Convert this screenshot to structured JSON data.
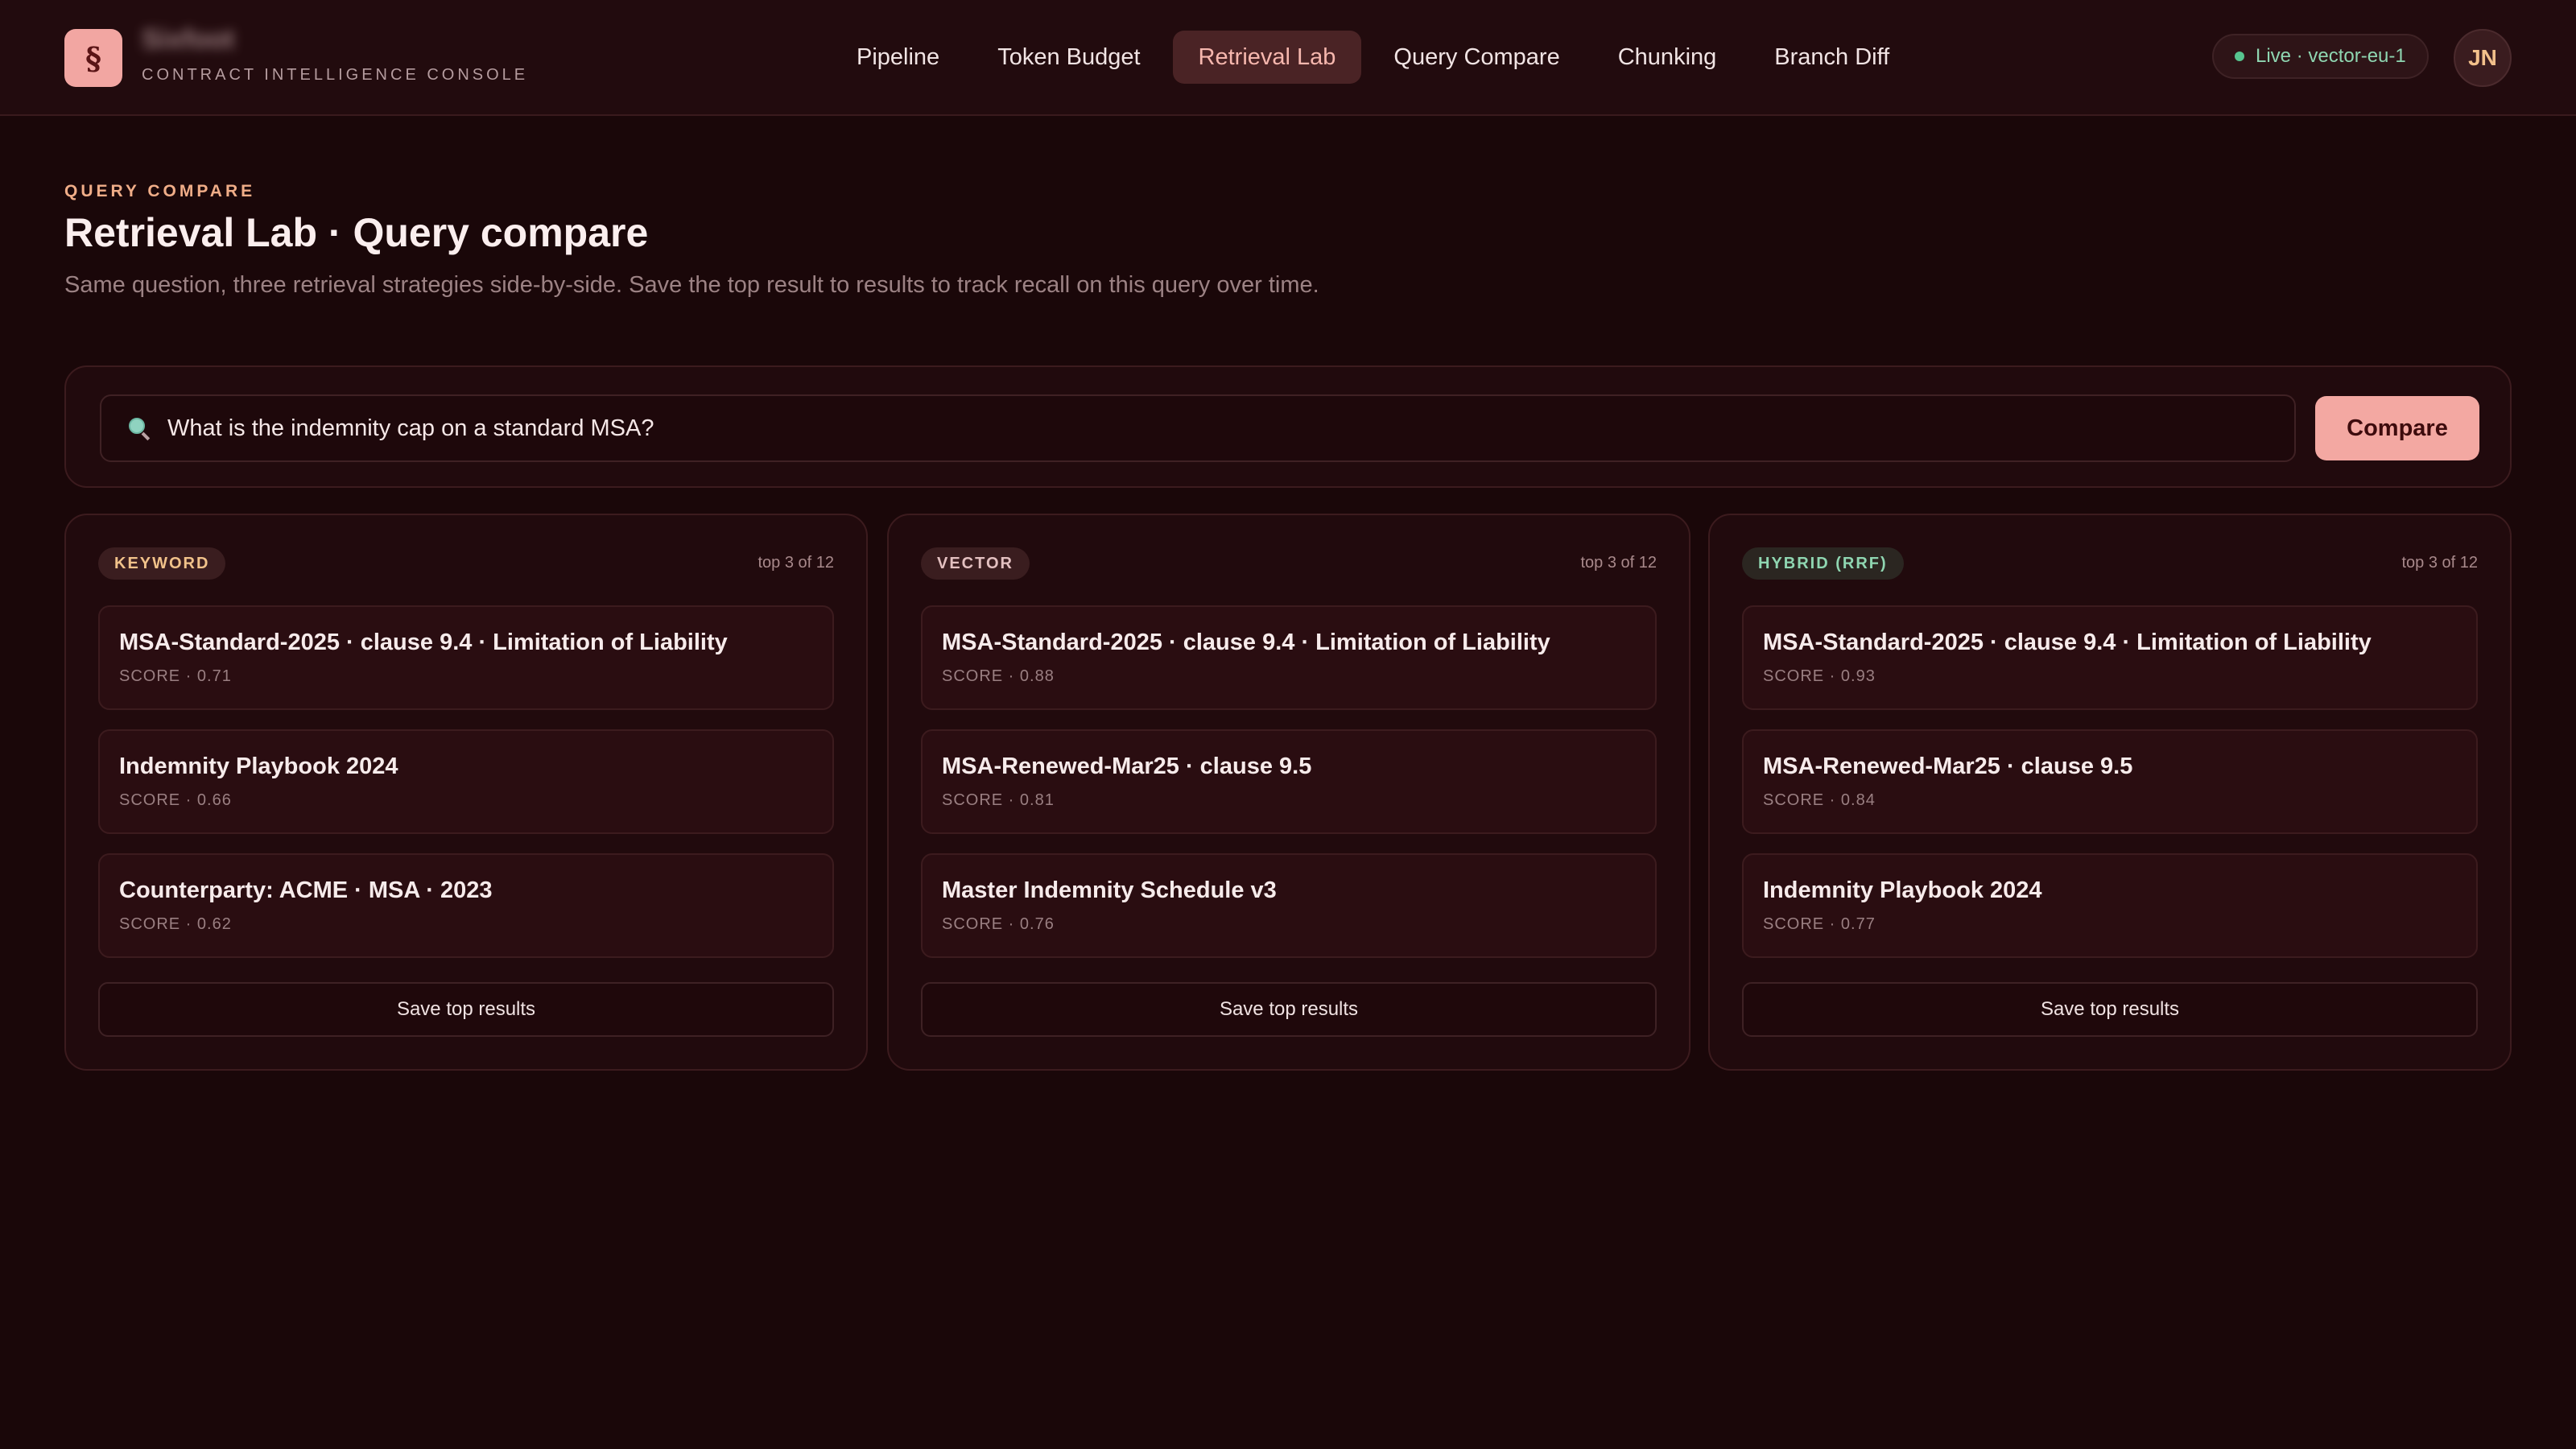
{
  "app": {
    "brand_name": "Sixfoot",
    "subtitle": "CONTRACT INTELLIGENCE CONSOLE",
    "logo_glyph": "§",
    "logo_color": "#f2a6a2"
  },
  "nav": {
    "items": [
      {
        "label": "Pipeline",
        "active": false
      },
      {
        "label": "Token Budget",
        "active": false
      },
      {
        "label": "Retrieval Lab",
        "active": true
      },
      {
        "label": "Query Compare",
        "active": false
      },
      {
        "label": "Chunking",
        "active": false
      },
      {
        "label": "Branch Diff",
        "active": false
      }
    ]
  },
  "status": {
    "label": "Live · vector-eu-1",
    "color": "#57c48f"
  },
  "user": {
    "initials": "JN"
  },
  "page": {
    "eyebrow": "QUERY COMPARE",
    "title": "Retrieval Lab · Query compare",
    "description": "Same question, three retrieval strategies side-by-side. Save the top result to results to track recall on this query over time."
  },
  "search": {
    "icon": "search-icon",
    "value": "What is the indemnity cap on a standard MSA?",
    "button_label": "Compare"
  },
  "strategies": [
    {
      "badge": "KEYWORD",
      "count": "top 3 of 12",
      "results": [
        {
          "title": "MSA-Standard-2025 · clause 9.4 · Limitation of Liability",
          "score": "SCORE · 0.71"
        },
        {
          "title": "Indemnity Playbook 2024",
          "score": "SCORE · 0.66"
        },
        {
          "title": "Counterparty: ACME · MSA · 2023",
          "score": "SCORE · 0.62"
        }
      ],
      "save_label": "Save top results"
    },
    {
      "badge": "VECTOR",
      "count": "top 3 of 12",
      "results": [
        {
          "title": "MSA-Standard-2025 · clause 9.4 · Limitation of Liability",
          "score": "SCORE · 0.88"
        },
        {
          "title": "MSA-Renewed-Mar25 · clause 9.5",
          "score": "SCORE · 0.81"
        },
        {
          "title": "Master Indemnity Schedule v3",
          "score": "SCORE · 0.76"
        }
      ],
      "save_label": "Save top results"
    },
    {
      "badge": "HYBRID (RRF)",
      "count": "top 3 of 12",
      "results": [
        {
          "title": "MSA-Standard-2025 · clause 9.4 · Limitation of Liability",
          "score": "SCORE · 0.93"
        },
        {
          "title": "MSA-Renewed-Mar25 · clause 9.5",
          "score": "SCORE · 0.84"
        },
        {
          "title": "Indemnity Playbook 2024",
          "score": "SCORE · 0.77"
        }
      ],
      "save_label": "Save top results"
    }
  ]
}
